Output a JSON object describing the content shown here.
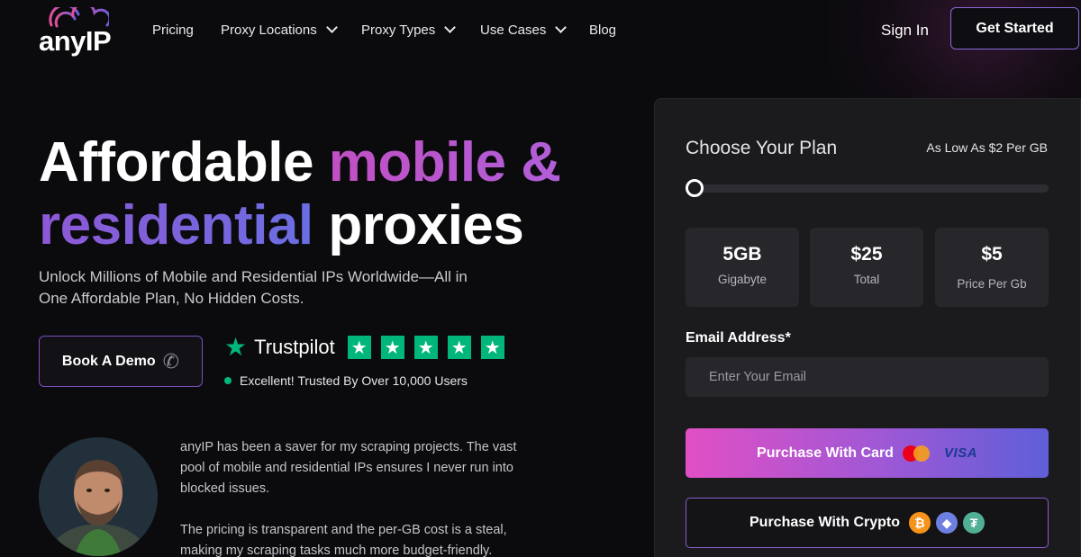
{
  "brand": {
    "logo_text": "anyIP"
  },
  "nav": {
    "items": [
      {
        "label": "Pricing",
        "dropdown": false
      },
      {
        "label": "Proxy Locations",
        "dropdown": true
      },
      {
        "label": "Proxy Types",
        "dropdown": true
      },
      {
        "label": "Use Cases",
        "dropdown": true
      },
      {
        "label": "Blog",
        "dropdown": false
      }
    ],
    "sign_in": "Sign In",
    "get_started": "Get Started"
  },
  "hero": {
    "headline_part1": "Affordable ",
    "headline_part2": "mobile &",
    "headline_part3": "residential",
    "headline_part4": " proxies",
    "subtext": "Unlock Millions of Mobile and Residential IPs Worldwide—All in One Affordable Plan, No Hidden Costs.",
    "demo_button": "Book A Demo"
  },
  "trustpilot": {
    "name": "Trustpilot",
    "rating_stars": 5,
    "subtitle": "Excellent! Trusted By Over 10,000 Users"
  },
  "testimonial": {
    "paragraph1": "anyIP has been a saver for my scraping projects. The vast pool of mobile and residential IPs ensures I never run into blocked issues.",
    "paragraph2": "The pricing is transparent and the per-GB cost is a steal, making my scraping tasks much more budget-friendly."
  },
  "plan": {
    "title": "Choose Your Plan",
    "low_price": "As Low As $2 Per GB",
    "slider_level": 0,
    "stats": [
      {
        "value": "5GB",
        "label": "Gigabyte"
      },
      {
        "value": "$25",
        "label": "Total"
      },
      {
        "value": "$5",
        "label": "Price Per Gb"
      }
    ],
    "email_label": "Email Address*",
    "email_placeholder": "Enter Your Email",
    "email_value": "",
    "card_button": "Purchase With Card",
    "visa_text": "VISA",
    "crypto_button": "Purchase With Crypto"
  },
  "colors": {
    "background": "#0b0b0d",
    "panel": "#1b1b1e",
    "accent_pink": "#e14fc5",
    "accent_purple": "#8b5ad0",
    "trustpilot_green": "#00b67a"
  },
  "icons": [
    "logo-wifi-icon",
    "chevron-down-icon",
    "phone-icon",
    "trustpilot-star-icon",
    "mastercard-icon",
    "visa-icon",
    "bitcoin-icon",
    "ethereum-icon",
    "tether-icon"
  ]
}
